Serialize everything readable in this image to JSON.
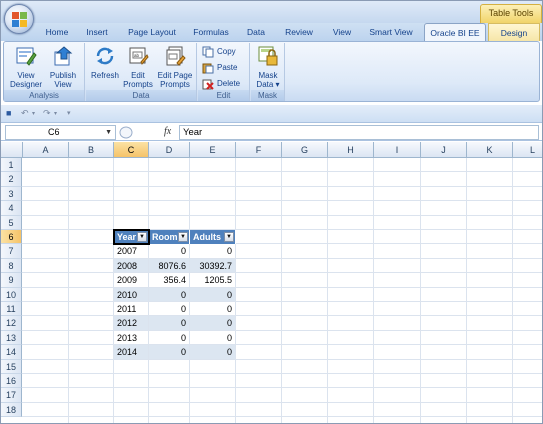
{
  "contextual_tab_group": "Table Tools",
  "tabs": [
    {
      "label": "Home"
    },
    {
      "label": "Insert"
    },
    {
      "label": "Page Layout"
    },
    {
      "label": "Formulas"
    },
    {
      "label": "Data"
    },
    {
      "label": "Review"
    },
    {
      "label": "View"
    },
    {
      "label": "Smart View"
    },
    {
      "label": "Oracle BI EE"
    },
    {
      "label": "Design"
    }
  ],
  "active_tab": "Oracle BI EE",
  "ribbon": {
    "analysis": {
      "label": "Analysis",
      "view_designer": {
        "line1": "View",
        "line2": "Designer"
      },
      "publish_view": {
        "line1": "Publish",
        "line2": "View"
      }
    },
    "data": {
      "label": "Data",
      "refresh": {
        "line1": "Refresh"
      },
      "edit_prompts": {
        "line1": "Edit",
        "line2": "Prompts"
      },
      "edit_page_prompts": {
        "line1": "Edit Page",
        "line2": "Prompts"
      }
    },
    "edit": {
      "label": "Edit",
      "copy": "Copy",
      "paste": "Paste",
      "delete": "Delete"
    },
    "mask": {
      "label": "Mask",
      "mask_data": {
        "line1": "Mask",
        "line2": "Data ▾"
      }
    }
  },
  "formula_bar": {
    "name_box": "C6",
    "fx_label": "fx",
    "value": "Year"
  },
  "grid": {
    "columns": [
      "A",
      "B",
      "C",
      "D",
      "E",
      "F",
      "G",
      "H",
      "I",
      "J",
      "K",
      "L"
    ],
    "rows": [
      "1",
      "2",
      "3",
      "4",
      "5",
      "6",
      "7",
      "8",
      "9",
      "10",
      "11",
      "12",
      "13",
      "14",
      "15",
      "16",
      "17",
      "18"
    ],
    "selected_column": "C",
    "selected_row": "6"
  },
  "table": {
    "headers": [
      "Year",
      "Room",
      "Adults"
    ],
    "rows": [
      [
        "2007",
        "0",
        "0"
      ],
      [
        "2008",
        "8076.6",
        "30392.7"
      ],
      [
        "2009",
        "356.4",
        "1205.5"
      ],
      [
        "2010",
        "0",
        "0"
      ],
      [
        "2011",
        "0",
        "0"
      ],
      [
        "2012",
        "0",
        "0"
      ],
      [
        "2013",
        "0",
        "0"
      ],
      [
        "2014",
        "0",
        "0"
      ]
    ]
  },
  "colors": {
    "table_header": "#4f81bd",
    "table_band": "#dce6f1",
    "ribbon_bg": "#dde9f8",
    "selected_header": "#f5c369"
  }
}
